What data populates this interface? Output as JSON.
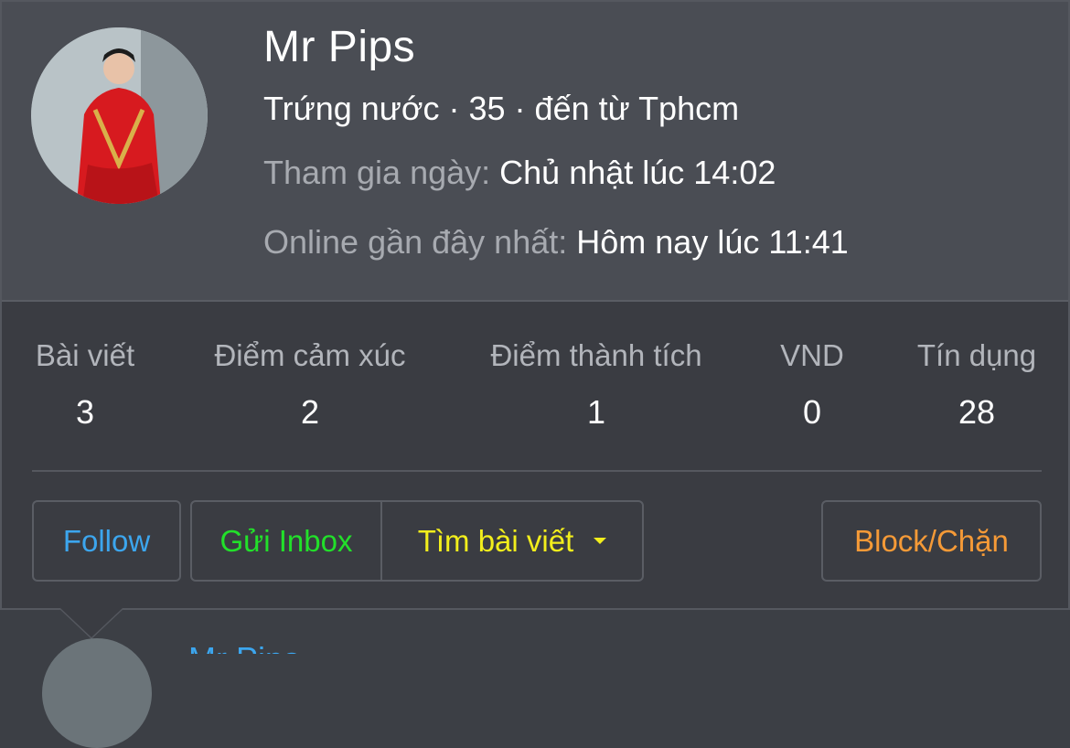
{
  "profile": {
    "name": "Mr Pips",
    "subtitle": "Trứng nước · 35 · đến từ Tphcm",
    "joined_label": "Tham gia ngày:",
    "joined_value": "Chủ nhật lúc 14:02",
    "online_label": "Online gần đây nhất:",
    "online_value": "Hôm nay lúc 11:41"
  },
  "stats": [
    {
      "label": "Bài viết",
      "value": "3"
    },
    {
      "label": "Điểm cảm xúc",
      "value": "2"
    },
    {
      "label": "Điểm thành tích",
      "value": "1"
    },
    {
      "label": "VND",
      "value": "0"
    },
    {
      "label": "Tín dụng",
      "value": "28"
    }
  ],
  "actions": {
    "follow": "Follow",
    "inbox": "Gửi Inbox",
    "find_posts": "Tìm bài viết",
    "block": "Block/Chặn"
  },
  "below": {
    "name_partial": "Mr Pips"
  },
  "colors": {
    "follow": "#3ca6ee",
    "inbox": "#22e02a",
    "find_posts": "#f2ee1c",
    "block": "#f59a37"
  },
  "icons": {
    "dropdown": "caret-down-icon"
  }
}
